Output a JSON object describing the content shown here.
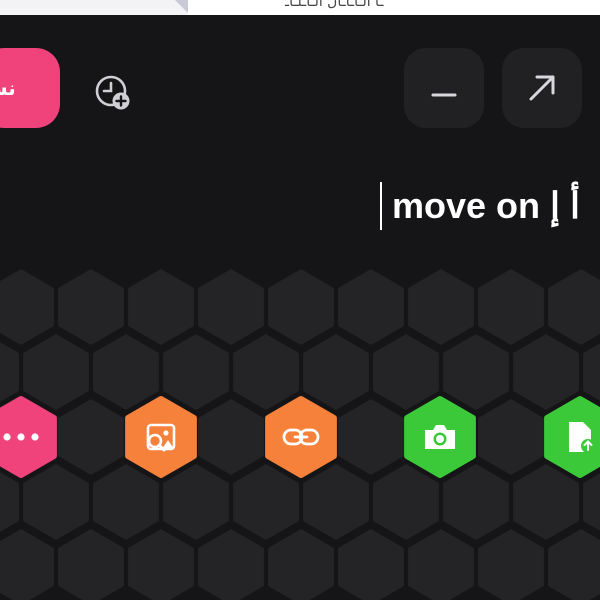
{
  "top_strip": {
    "text": "ـا الـاـاـال الـاـلـاـ"
  },
  "toolbar": {
    "publish_label": "نش",
    "schedule_icon": "clock-plus-icon",
    "minimize_icon": "minimize-icon",
    "expand_icon": "expand-arrow-icon"
  },
  "editor": {
    "text": "move on",
    "rtl_fragment": "أ إ"
  },
  "actions": [
    {
      "name": "more-options",
      "icon": "dots-icon",
      "color": "#f0427b"
    },
    {
      "name": "image-search",
      "icon": "image-search-icon",
      "color": "#f5813a"
    },
    {
      "name": "link",
      "icon": "link-icon",
      "color": "#f5813a"
    },
    {
      "name": "camera",
      "icon": "camera-icon",
      "color": "#3bc93a"
    },
    {
      "name": "file-upload",
      "icon": "file-upload-icon",
      "color": "#3bc93a"
    }
  ],
  "colors": {
    "background": "#151517",
    "hex_tile": "#242427",
    "publish": "#f0427b",
    "orange": "#f5813a",
    "green": "#3bc93a"
  }
}
